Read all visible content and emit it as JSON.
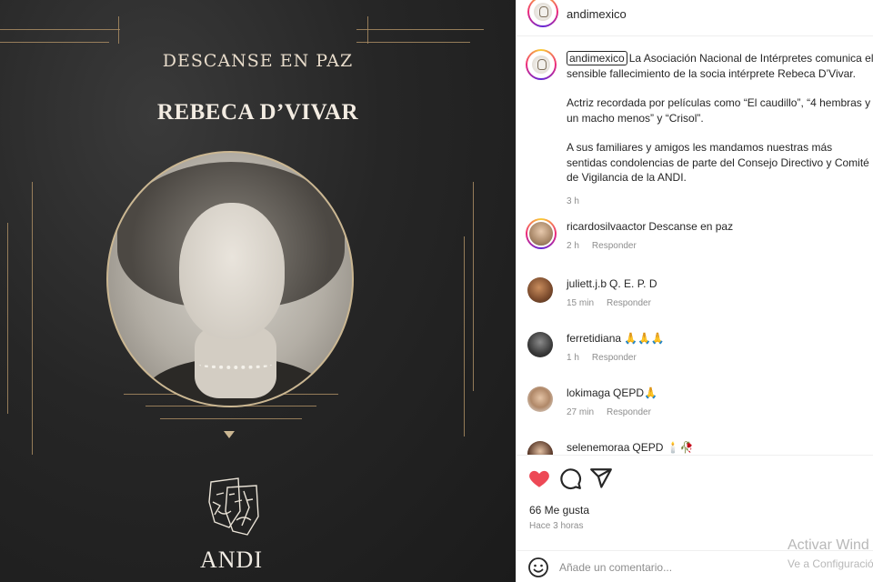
{
  "post_image": {
    "heading": "DESCANSE EN PAZ",
    "name": "REBECA D’VIVAR",
    "logo_text": "ANDI",
    "accent_color": "#a98c63"
  },
  "header": {
    "username": "andimexico",
    "avatar_icon": "andi-logo-avatar"
  },
  "caption": {
    "username": "andimexico",
    "paragraph1": "La Asociación Nacional de Intérpretes comunica el sensible fallecimiento de la socia intérprete Rebeca D’Vivar.",
    "paragraph2": "Actriz recordada por películas como “El caudillo”, “4 hembras y un macho menos” y “Crisol”.",
    "paragraph3": "A sus familiares y amigos les mandamos nuestras más sentidas condolencias de parte del Consejo Directivo y Comité de Vigilancia de la ANDI.",
    "time": "3 h"
  },
  "comments": [
    {
      "user": "ricardosilvaactor",
      "text": "Descanse en paz",
      "time": "2 h",
      "reply": "Responder"
    },
    {
      "user": "juliett.j.b",
      "text": "Q. E. P. D",
      "time": "15 min",
      "reply": "Responder"
    },
    {
      "user": "ferretidiana",
      "text": "🙏🙏🙏",
      "time": "1 h",
      "reply": "Responder"
    },
    {
      "user": "lokimaga",
      "text": "QEPD🙏",
      "time": "27 min",
      "reply": "Responder"
    },
    {
      "user": "selenemoraa",
      "text": "QEPD 🕯️🥀",
      "time": "",
      "reply": ""
    }
  ],
  "actions": {
    "like_icon": "heart-filled-icon",
    "comment_icon": "comment-icon",
    "share_icon": "send-icon",
    "likes": "66 Me gusta",
    "time": "Hace 3 horas",
    "like_color": "#ed4956"
  },
  "add_comment": {
    "placeholder": "Añade un comentario..."
  },
  "watermark": {
    "line1": "Activar Wind",
    "line2": "Ve a Configuració"
  }
}
